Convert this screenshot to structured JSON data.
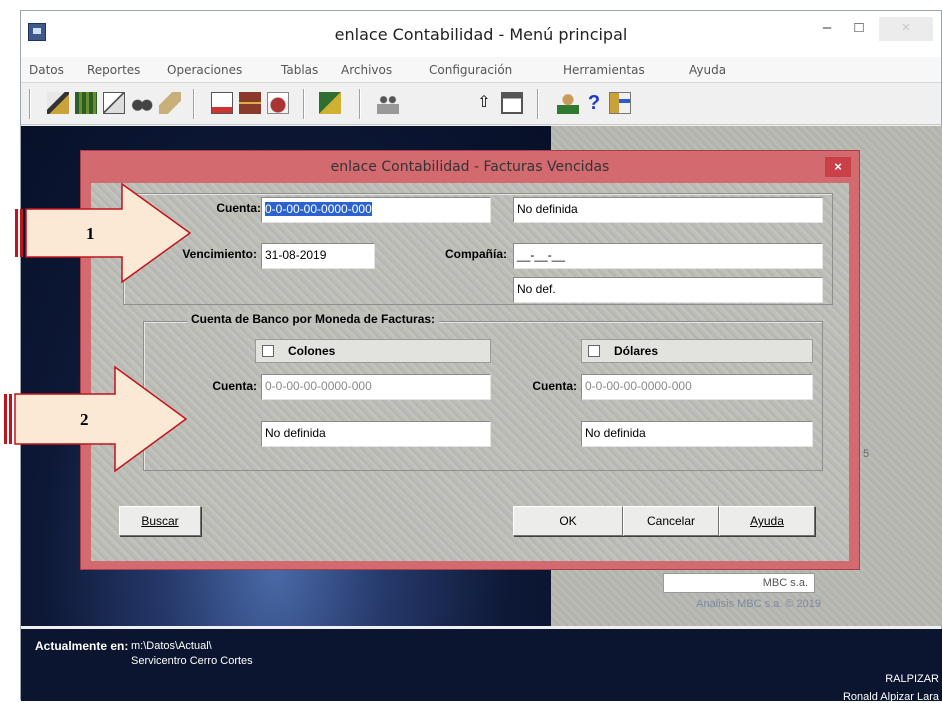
{
  "window": {
    "title": "enlace Contabilidad - Menú principal",
    "min": "–",
    "max": "□",
    "close": "×"
  },
  "menu": [
    "Datos",
    "Reportes",
    "Operaciones",
    "Tablas",
    "Archivos",
    "Configuración",
    "Herramientas",
    "Ayuda"
  ],
  "toolbar_icons": [
    "printer-icon",
    "books-icon",
    "copy-icon",
    "binoculars-icon",
    "eraser-icon",
    "chart-icon",
    "cabinet-icon",
    "hand-icon",
    "book-icon",
    "users-icon",
    "up-arrow-icon",
    "windows-icon",
    "person-icon",
    "help-icon",
    "exit-door-icon"
  ],
  "background": {
    "mbc_box": "MBC s.a.",
    "copyright": "Analisis MBC s.a. © 2019",
    "side_number": "5"
  },
  "status": {
    "label": "Actualmente en:",
    "path": "m:\\Datos\\Actual\\",
    "company": "Servicentro Cerro Cortes",
    "user": "RALPIZAR",
    "user_name": "Ronald Alpizar Lara"
  },
  "dialog": {
    "title": "enlace Contabilidad - Facturas Vencidas",
    "close": "×",
    "cuenta_label": "Cuenta:",
    "cuenta_value": "0-0-00-00-0000-000",
    "cuenta_desc": "No definida",
    "vencimiento_label": "Vencimiento:",
    "vencimiento_value": "31-08-2019",
    "compania_label": "Compañía:",
    "compania_value": "__-__-__",
    "compania_desc": "No def.",
    "bank_group_title": "Cuenta de Banco por Moneda de Facturas:",
    "colones": {
      "checkbox_label": "Colones",
      "checked": false,
      "cuenta_label": "Cuenta:",
      "cuenta_value": "0-0-00-00-0000-000",
      "desc": "No definida"
    },
    "dolares": {
      "checkbox_label": "Dólares",
      "checked": false,
      "cuenta_label": "Cuenta:",
      "cuenta_value": "0-0-00-00-0000-000",
      "desc": "No definida"
    },
    "buttons": {
      "buscar": "Buscar",
      "ok": "OK",
      "cancelar": "Cancelar",
      "ayuda": "Ayuda"
    }
  },
  "annotations": {
    "arrow1": "1",
    "arrow2": "2",
    "arrow_fill": "#fbe9d6",
    "arrow_stroke": "#c0141c"
  }
}
